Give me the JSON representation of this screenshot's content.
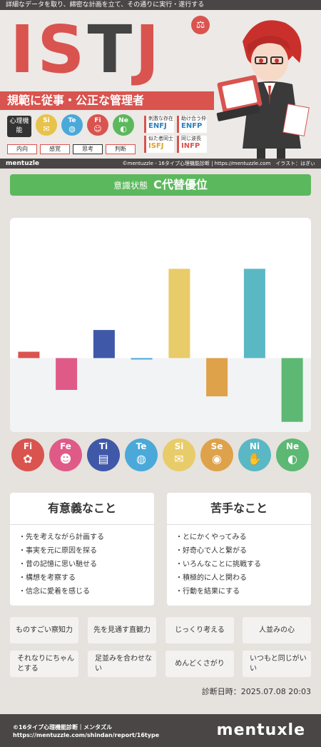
{
  "hero": {
    "tagline": "詳細なデータを取り、綿密な計画を立て、その通りに実行・遂行する",
    "type_letters": [
      "I",
      "S",
      "T",
      "J"
    ],
    "letter_colors": [
      "#d9534f",
      "#d9534f",
      "#444444",
      "#d9534f"
    ],
    "scale_icon": "balance-scale-icon",
    "title": "規範に従事・公正な管理者",
    "func_label": "心理機能",
    "mini_functions": [
      {
        "name": "Si",
        "icon": "envelope-icon",
        "color": "#e8c34a"
      },
      {
        "name": "Te",
        "icon": "globe-icon",
        "color": "#4aa9d9"
      },
      {
        "name": "Fi",
        "icon": "person-icon",
        "color": "#d9534f"
      },
      {
        "name": "Ne",
        "icon": "planet-icon",
        "color": "#5cb85c"
      }
    ],
    "attributes": [
      "内向",
      "感覚",
      "思考",
      "判断"
    ],
    "relations": [
      {
        "label": "刺激な存在",
        "type": "ENFJ"
      },
      {
        "label": "助け合う仲",
        "type": "ENFP"
      },
      {
        "label": "似た者同士",
        "type": "ISFJ"
      },
      {
        "label": "同じ波長",
        "type": "INFP"
      }
    ]
  },
  "credit": {
    "logo": "mentuzle",
    "text": "©mentuzzle - 16タイプ心理機能診断 | https://mentuzzle.com　イラスト：はぎぃ"
  },
  "state": {
    "label": "意識状態",
    "value": "C代替優位"
  },
  "chart_data": {
    "type": "bar",
    "categories": [
      "Fi",
      "Fe",
      "Ti",
      "Te",
      "Si",
      "Se",
      "Ni",
      "Ne"
    ],
    "values": [
      5,
      -25,
      22,
      -1,
      70,
      -30,
      70,
      -50
    ],
    "colors": [
      "#d9534f",
      "#e05a88",
      "#3f58a8",
      "#4aa9d9",
      "#e8cc6a",
      "#dea24a",
      "#5ab8c4",
      "#5cb873"
    ],
    "ylim": [
      -58,
      110
    ]
  },
  "functions": [
    {
      "name": "Fi",
      "icon": "person-child-icon",
      "glyph": "✿",
      "color": "#d9534f"
    },
    {
      "name": "Fe",
      "icon": "people-icon",
      "glyph": "☻",
      "color": "#e05a88"
    },
    {
      "name": "Ti",
      "icon": "book-icon",
      "glyph": "▤",
      "color": "#3f58a8"
    },
    {
      "name": "Te",
      "icon": "globe-icon",
      "glyph": "◍",
      "color": "#4aa9d9"
    },
    {
      "name": "Si",
      "icon": "envelope-icon",
      "glyph": "✉",
      "color": "#e8cc6a"
    },
    {
      "name": "Se",
      "icon": "camera-icon",
      "glyph": "◉",
      "color": "#dea24a"
    },
    {
      "name": "Ni",
      "icon": "handshake-icon",
      "glyph": "✋",
      "color": "#5ab8c4"
    },
    {
      "name": "Ne",
      "icon": "planet-icon",
      "glyph": "◐",
      "color": "#5cb873"
    }
  ],
  "meaningful": {
    "title": "有意義なこと",
    "items": [
      "・先を考えながら計画する",
      "・事実を元に原因を探る",
      "・昔の記憶に思い馳せる",
      "・構想を考察する",
      "・信念に愛着を感じる"
    ]
  },
  "weak": {
    "title": "苦手なこと",
    "items": [
      "・とにかくやってみる",
      "・好奇心で人と繋がる",
      "・いろんなことに挑戦する",
      "・積極的に人と関わる",
      "・行動を結果にする"
    ]
  },
  "tags": [
    [
      "ものすごい察知力",
      "先を見通す直観力",
      "じっくり考える",
      "人並みの心"
    ],
    [
      "それなりにちゃんとする",
      "足並みを合わせない",
      "めんどくさがり",
      "いつもと同じがいい"
    ]
  ],
  "diag_date": "診断日時：2025.07.08 20:03",
  "footer": {
    "copyright": "©16タイプ心理機能診断｜メンタズル",
    "url": "https://mentuzzle.com/shindan/report/16type",
    "logo": "mentuxle"
  }
}
